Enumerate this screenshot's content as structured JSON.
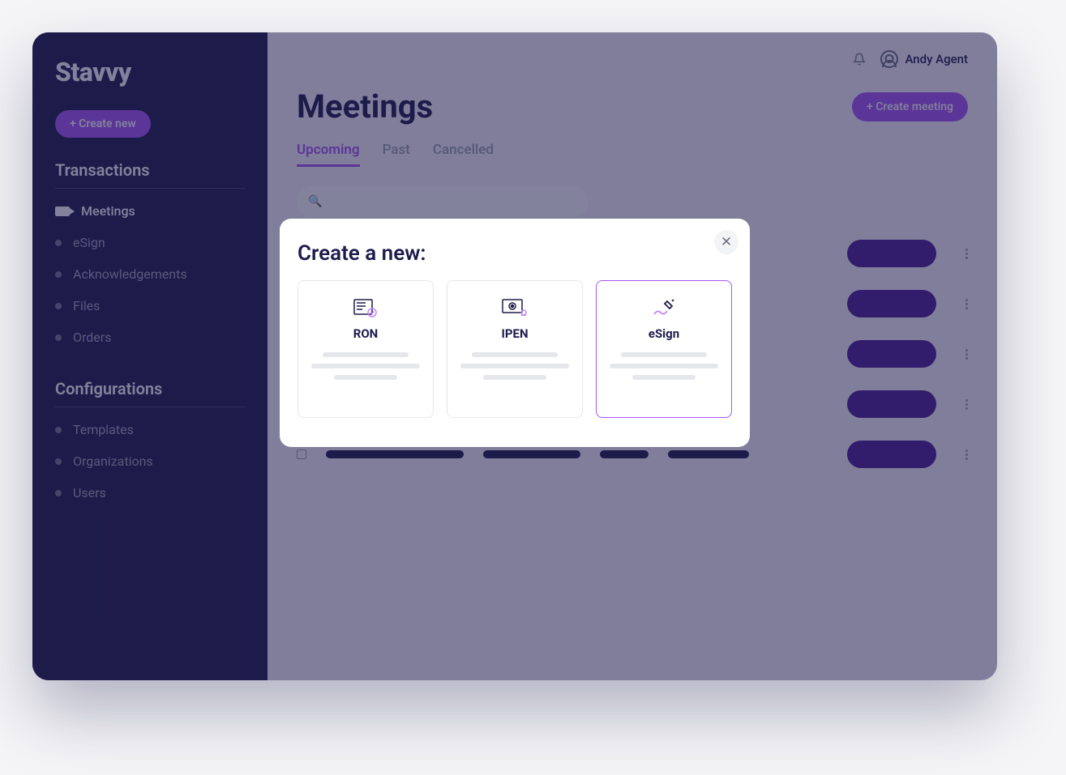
{
  "brand": "Stavvy",
  "sidebar": {
    "create_label": "+ Create new",
    "sections": [
      {
        "title": "Transactions",
        "items": [
          {
            "label": "Meetings",
            "active": true,
            "icon": "camera"
          },
          {
            "label": "eSign",
            "active": false
          },
          {
            "label": "Acknowledgements",
            "active": false
          },
          {
            "label": "Files",
            "active": false
          },
          {
            "label": "Orders",
            "active": false
          }
        ]
      },
      {
        "title": "Configurations",
        "items": [
          {
            "label": "Templates",
            "active": false
          },
          {
            "label": "Organizations",
            "active": false
          },
          {
            "label": "Users",
            "active": false
          }
        ]
      }
    ]
  },
  "header": {
    "user_name": "Andy Agent"
  },
  "page": {
    "title": "Meetings",
    "create_meeting_label": "+ Create meeting",
    "tabs": [
      {
        "label": "Upcoming",
        "active": true
      },
      {
        "label": "Past",
        "active": false
      },
      {
        "label": "Cancelled",
        "active": false
      }
    ]
  },
  "modal": {
    "title": "Create a new:",
    "options": [
      {
        "label": "RON",
        "selected": false
      },
      {
        "label": "IPEN",
        "selected": false
      },
      {
        "label": "eSign",
        "selected": true
      }
    ]
  },
  "colors": {
    "accent": "#a855f7",
    "brand_dark": "#1e1b4b",
    "pill": "#4c1d95"
  }
}
